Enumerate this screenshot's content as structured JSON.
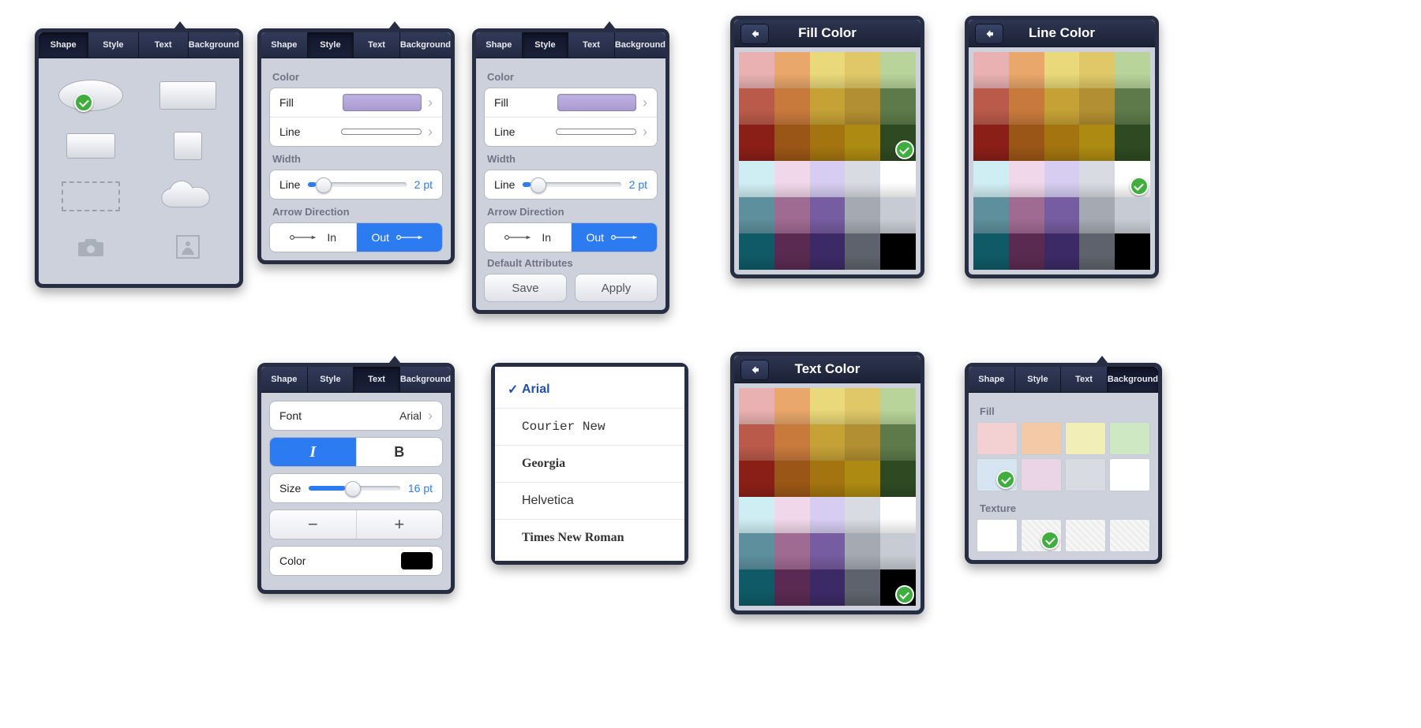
{
  "tabs": {
    "shape": "Shape",
    "style": "Style",
    "text": "Text",
    "background": "Background"
  },
  "style_panel": {
    "color_header": "Color",
    "fill_label": "Fill",
    "line_label": "Line",
    "fill_color": "#b3a6d8",
    "width_header": "Width",
    "width_label": "Line",
    "width_value": "2 pt",
    "arrow_header": "Arrow Direction",
    "arrow_in": "In",
    "arrow_out": "Out",
    "defaults_header": "Default Attributes",
    "save": "Save",
    "apply": "Apply"
  },
  "fill_picker": {
    "title": "Fill Color"
  },
  "line_picker": {
    "title": "Line Color"
  },
  "palette": [
    "#e9b1b1",
    "#e9a76b",
    "#e9d97a",
    "#e0c868",
    "#b8d49a",
    "#b95a4a",
    "#c87a3c",
    "#c6a236",
    "#b28f32",
    "#5e7a4a",
    "#8a1f17",
    "#9a5616",
    "#a37410",
    "#ad8a12",
    "#2e4a22",
    "#cfeef3",
    "#f0d8ea",
    "#d6cdf0",
    "#d8dbe1",
    "#ffffff",
    "#5d8f9c",
    "#a06b92",
    "#765ca0",
    "#a4a9b2",
    "#c7cbd3",
    "#0f5a66",
    "#5a2a52",
    "#3b2a66",
    "#5d626c",
    "#000000"
  ],
  "fill_selected_index": 14,
  "line_selected_index": 19,
  "textcolor_selected_index": 29,
  "text_panel": {
    "font_label": "Font",
    "font_value": "Arial",
    "size_label": "Size",
    "size_value": "16 pt",
    "color_label": "Color",
    "color_value": "#000000"
  },
  "fonts": [
    "Arial",
    "Courier New",
    "Georgia",
    "Helvetica",
    "Times New Roman"
  ],
  "font_selected": "Arial",
  "bg_panel": {
    "fill_header": "Fill",
    "texture_header": "Texture",
    "fill_colors": [
      "#f3d0d2",
      "#f4c9a6",
      "#f2eeb8",
      "#cde8c3",
      "#d7e5f2",
      "#ead5e6",
      "#d8dbe1",
      "#ffffff"
    ],
    "fill_selected_index": 4,
    "texture_selected_index": 1,
    "texture_count": 4
  }
}
